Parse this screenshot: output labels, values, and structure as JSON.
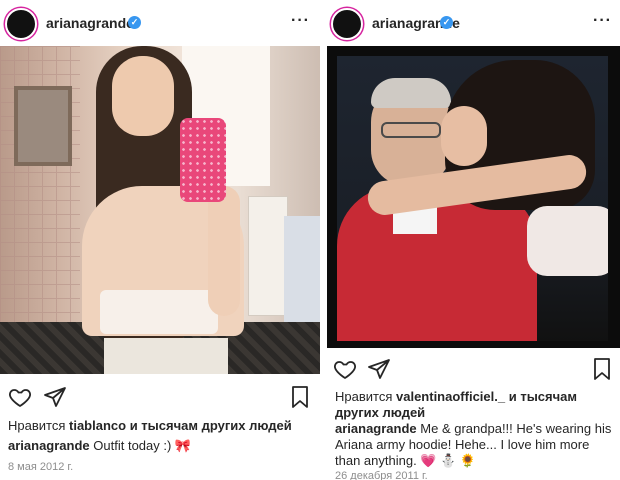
{
  "left_post": {
    "username": "arianagrande",
    "verified_mark": "✓",
    "more_label": "···",
    "likes_prefix": "Нравится",
    "likes_user": "tiablanco",
    "likes_suffix": "и тысячам других людей",
    "caption_user": "arianagrande",
    "caption_text": "Outfit today :) 🎀",
    "date": "8 мая 2012 г."
  },
  "right_post": {
    "username": "arianagrande",
    "verified_mark": "✓",
    "more_label": "···",
    "likes_prefix": "Нравится",
    "likes_user": "valentinaofficiel._",
    "likes_suffix": "и тысячам других людей",
    "caption_user": "arianagrande",
    "caption_text": "Me & grandpa!!! He's wearing his Ariana army hoodie! Hehe... I love him more than anything. 💗 ⛄ 🌻",
    "date": "26 декабря 2011 г."
  },
  "icons": {
    "like": "heart-icon",
    "share": "paper-plane-icon",
    "save": "bookmark-icon",
    "more": "more-options-icon",
    "verified": "verified-badge-icon"
  },
  "colors": {
    "text": "#262626",
    "muted": "#8e8e8e",
    "verified": "#3897f0"
  }
}
